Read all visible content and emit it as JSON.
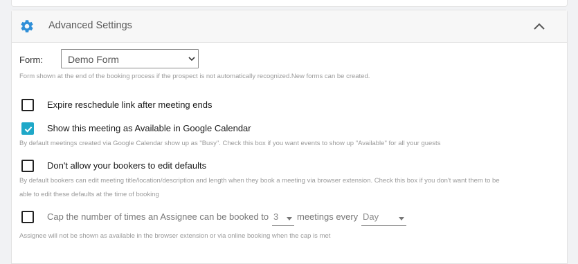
{
  "header": {
    "title": "Advanced Settings"
  },
  "form": {
    "label": "Form:",
    "selected": "Demo Form",
    "help": "Form shown at the end of the booking process if the prospect is not automatically recognized.New forms can be created."
  },
  "options": {
    "expire": {
      "label": "Expire reschedule link after meeting ends",
      "checked": false
    },
    "available": {
      "label": "Show this meeting as Available in Google Calendar",
      "checked": true,
      "help": "By default meetings created via Google Calendar show up as \"Busy\". Check this box if you want events to show up \"Available\" for all your guests"
    },
    "no_edit": {
      "label": "Don't allow your bookers to edit defaults",
      "checked": false,
      "help_line1": "By default bookers can edit meeting title/location/description and length when they book a meeting via browser extension. Check this box if you don't want them to be",
      "help_line2": "able to edit these defaults at the time of booking"
    },
    "cap": {
      "label_prefix": "Cap the number of times an Assignee can be booked to",
      "count": "3",
      "label_mid": "meetings every",
      "period": "Day",
      "checked": false,
      "help": "Assignee will not be shown as available in the browser extension or via online booking when the cap is met"
    }
  },
  "colors": {
    "accent": "#1fa8c8",
    "gear": "#2f8fd8"
  }
}
